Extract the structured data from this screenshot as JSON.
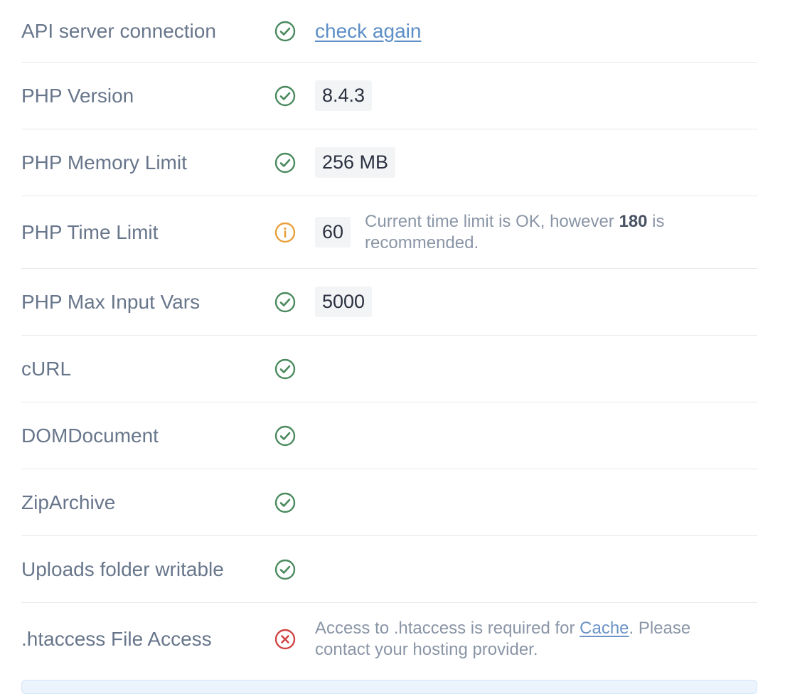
{
  "colors": {
    "ok": "#4a8a5e",
    "warning": "#e8a03a",
    "error": "#d14545",
    "link": "#5c8ec7",
    "badge_bg": "#f3f4f6",
    "label": "#68768b",
    "divider": "#e6e8ec"
  },
  "rows": [
    {
      "label": "API server connection",
      "status": "ok",
      "icon": "check-circle-icon",
      "link": "check again"
    },
    {
      "label": "PHP Version",
      "status": "ok",
      "icon": "check-circle-icon",
      "value": "8.4.3"
    },
    {
      "label": "PHP Memory Limit",
      "status": "ok",
      "icon": "check-circle-icon",
      "value": "256 MB"
    },
    {
      "label": "PHP Time Limit",
      "status": "warning",
      "icon": "info-circle-icon",
      "value": "60",
      "note": {
        "before": "Current time limit is OK, however ",
        "bold": "180",
        "after": " is recommended."
      }
    },
    {
      "label": "PHP Max Input Vars",
      "status": "ok",
      "icon": "check-circle-icon",
      "value": "5000"
    },
    {
      "label": "cURL",
      "status": "ok",
      "icon": "check-circle-icon"
    },
    {
      "label": "DOMDocument",
      "status": "ok",
      "icon": "check-circle-icon"
    },
    {
      "label": "ZipArchive",
      "status": "ok",
      "icon": "check-circle-icon"
    },
    {
      "label": "Uploads folder writable",
      "status": "ok",
      "icon": "check-circle-icon"
    },
    {
      "label": ".htaccess File Access",
      "status": "error",
      "icon": "x-circle-icon",
      "note": {
        "before": "Access to .htaccess is required for ",
        "link": "Cache",
        "after": ". Please contact your hosting provider."
      }
    }
  ]
}
